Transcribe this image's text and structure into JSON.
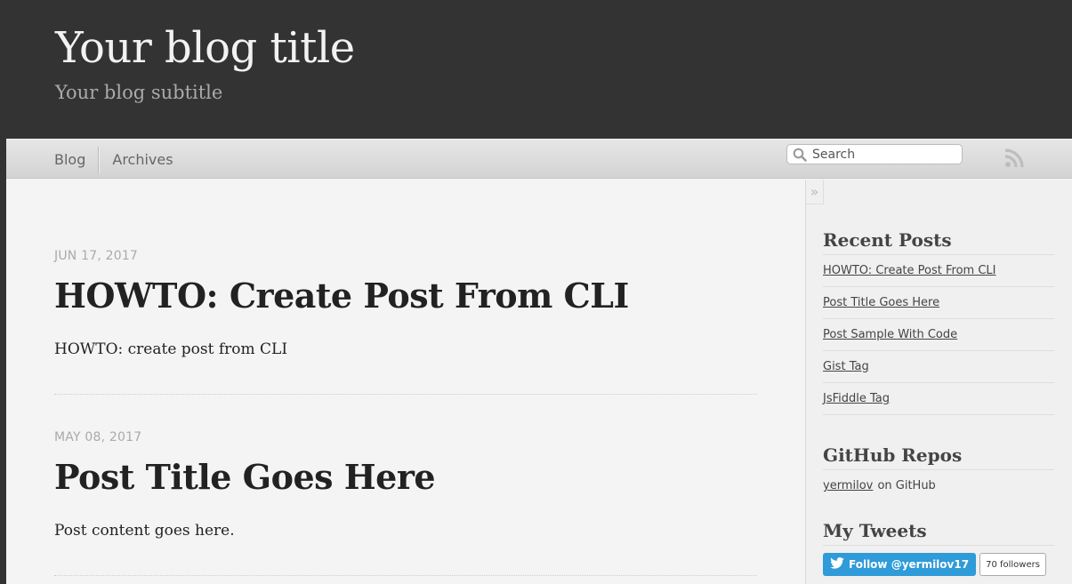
{
  "header": {
    "title": "Your blog title",
    "subtitle": "Your blog subtitle"
  },
  "nav": {
    "links": [
      "Blog",
      "Archives"
    ],
    "search_placeholder": "Search",
    "rss_icon": "rss-icon"
  },
  "posts": [
    {
      "date": "JUN 17, 2017",
      "title": "HOWTO: Create Post From CLI",
      "excerpt": "HOWTO: create post from CLI"
    },
    {
      "date": "MAY 08, 2017",
      "title": "Post Title Goes Here",
      "excerpt": "Post content goes here."
    }
  ],
  "sidebar": {
    "collapse_glyph": "»",
    "recent_posts": {
      "heading": "Recent Posts",
      "items": [
        "HOWTO: Create Post From CLI",
        "Post Title Goes Here",
        "Post Sample With Code",
        "Gist Tag",
        "JsFiddle Tag"
      ]
    },
    "github": {
      "heading": "GitHub Repos",
      "user": "yermilov",
      "suffix": "on GitHub"
    },
    "tweets": {
      "heading": "My Tweets",
      "follow_label": "Follow @yermilov17",
      "followers": "70 followers"
    }
  },
  "colors": {
    "header_bg": "#333333",
    "page_bg": "#f4f4f4",
    "twitter_blue": "#2f9bd9"
  }
}
